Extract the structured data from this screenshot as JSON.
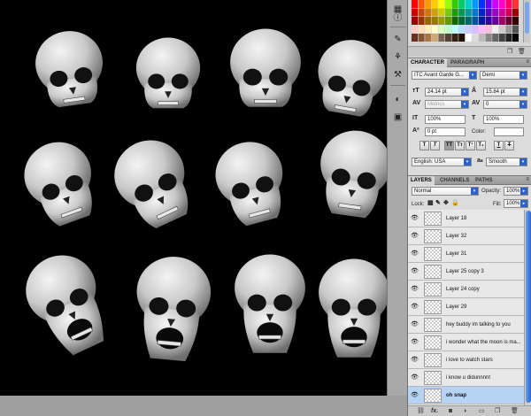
{
  "colors": {
    "accent": "#2f62c8",
    "selection": "#b7d3f4",
    "canvas": "#000000"
  },
  "swatches": {
    "rows": [
      [
        "#ff0000",
        "#ff5500",
        "#ff9900",
        "#ffcc00",
        "#ffff00",
        "#99ff00",
        "#33cc00",
        "#00cc66",
        "#00cccc",
        "#0099ff",
        "#0033ff",
        "#6600ff",
        "#cc00ff",
        "#ff00cc",
        "#ff0066",
        "#ff3333"
      ],
      [
        "#cc0000",
        "#cc4400",
        "#cc7700",
        "#cca300",
        "#cccc00",
        "#77cc00",
        "#229900",
        "#009955",
        "#009999",
        "#0077cc",
        "#0022cc",
        "#5500cc",
        "#9900cc",
        "#cc0099",
        "#cc0055",
        "#990000"
      ],
      [
        "#990000",
        "#993300",
        "#996600",
        "#997700",
        "#999900",
        "#669900",
        "#116600",
        "#006633",
        "#006666",
        "#005599",
        "#001999",
        "#330099",
        "#660099",
        "#990066",
        "#660033",
        "#330000"
      ],
      [
        "#ffcccc",
        "#ffddbb",
        "#ffeebb",
        "#ffffcc",
        "#ddffbb",
        "#bbffcc",
        "#bbffff",
        "#bbddff",
        "#ccccff",
        "#ddbbff",
        "#ffbbff",
        "#ffbbdd",
        "#eeeeee",
        "#cccccc",
        "#999999",
        "#555555"
      ],
      [
        "#663322",
        "#885533",
        "#aa7744",
        "#ccaa77",
        "#776655",
        "#554433",
        "#332211",
        "#221100",
        "#ffffff",
        "#dddddd",
        "#bbbbbb",
        "#888888",
        "#666666",
        "#444444",
        "#222222",
        "#000000"
      ]
    ]
  },
  "character_panel": {
    "tabs": [
      "CHARACTER",
      "PARAGRAPH"
    ],
    "font_family": "ITC Avant Garde G...",
    "font_style": "Demi",
    "font_size": "24.14 pt",
    "leading": "15.84 pt",
    "kerning": "Metrics",
    "tracking": "0",
    "vertical_scale": "100%",
    "horizontal_scale": "100%",
    "baseline_shift": "0 pt",
    "color_label": "Color:",
    "style_buttons": [
      "T",
      "T",
      "TT",
      "Tт",
      "T¹",
      "T₁",
      "T",
      "T"
    ],
    "language": "English: USA",
    "aa_label": "a",
    "antialias": "Smooth"
  },
  "layers_panel": {
    "tabs": [
      "LAYERS",
      "CHANNELS",
      "PATHS"
    ],
    "blend_mode": "Normal",
    "opacity_label": "Opacity:",
    "opacity": "100%",
    "lock_label": "Lock:",
    "fill_label": "Fill:",
    "fill": "100%",
    "layers": [
      {
        "name": "Layer 18",
        "selected": false
      },
      {
        "name": "Layer 32",
        "selected": false
      },
      {
        "name": "Layer 31",
        "selected": false
      },
      {
        "name": "Layer 25 copy 3",
        "selected": false
      },
      {
        "name": "Layer 24 copy",
        "selected": false
      },
      {
        "name": "Layer 29",
        "selected": false
      },
      {
        "name": "hey buddy im talking to you",
        "selected": false
      },
      {
        "name": "i wonder what the moon is ma...",
        "selected": false
      },
      {
        "name": "i love to watch stars",
        "selected": false
      },
      {
        "name": "i know u didunnnnt",
        "selected": false
      },
      {
        "name": "oh snap",
        "selected": true
      }
    ],
    "footer_fx": "fx."
  }
}
